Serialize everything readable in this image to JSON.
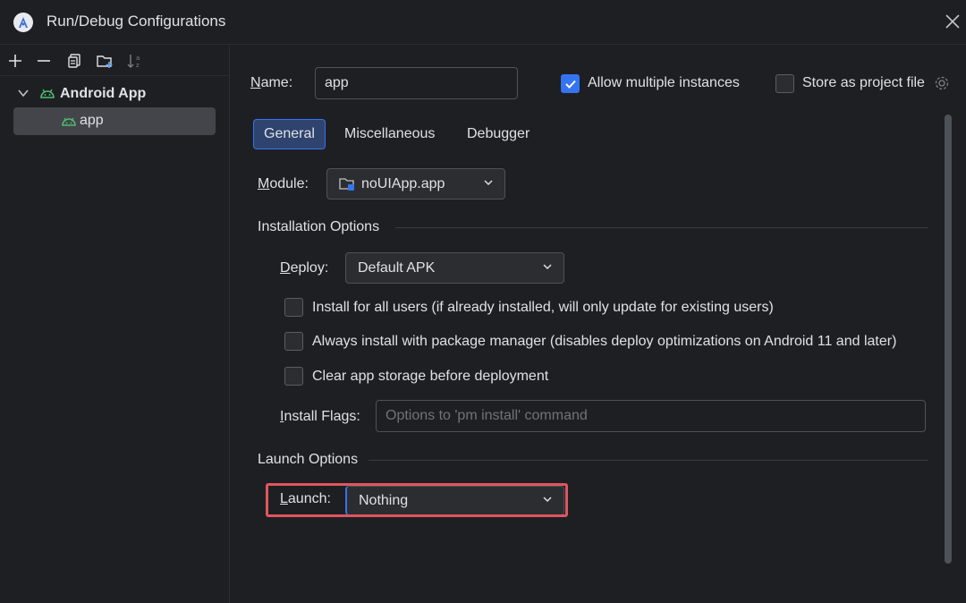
{
  "window": {
    "title": "Run/Debug Configurations"
  },
  "sidebar": {
    "toolbar": [
      {
        "icon": "plus-icon"
      },
      {
        "icon": "minus-icon"
      },
      {
        "icon": "copy-icon"
      },
      {
        "icon": "new-folder-icon"
      },
      {
        "icon": "sort-az-icon"
      }
    ],
    "group_label": "Android App",
    "item_label": "app"
  },
  "form": {
    "name_label": "Name:",
    "name_value": "app",
    "allow_multiple_label": "Allow multiple instances",
    "allow_multiple_checked": true,
    "store_project_label": "Store as project file",
    "store_project_checked": false,
    "tabs": [
      "General",
      "Miscellaneous",
      "Debugger"
    ],
    "active_tab": "General",
    "module_label": "Module:",
    "module_value": "noUIApp.app",
    "installation_section": "Installation Options",
    "deploy_label": "Deploy:",
    "deploy_value": "Default APK",
    "install_all_users": "Install for all users (if already installed, will only update for existing users)",
    "always_install_pm": "Always install with package manager (disables deploy optimizations on Android 11 and later)",
    "clear_storage": "Clear app storage before deployment",
    "install_flags_label": "Install Flags:",
    "install_flags_placeholder": "Options to 'pm install' command",
    "launch_section": "Launch Options",
    "launch_label": "Launch:",
    "launch_value": "Nothing"
  },
  "colors": {
    "accent": "#3574f0",
    "highlight": "#e05561",
    "android_green": "#4ebf6f"
  }
}
